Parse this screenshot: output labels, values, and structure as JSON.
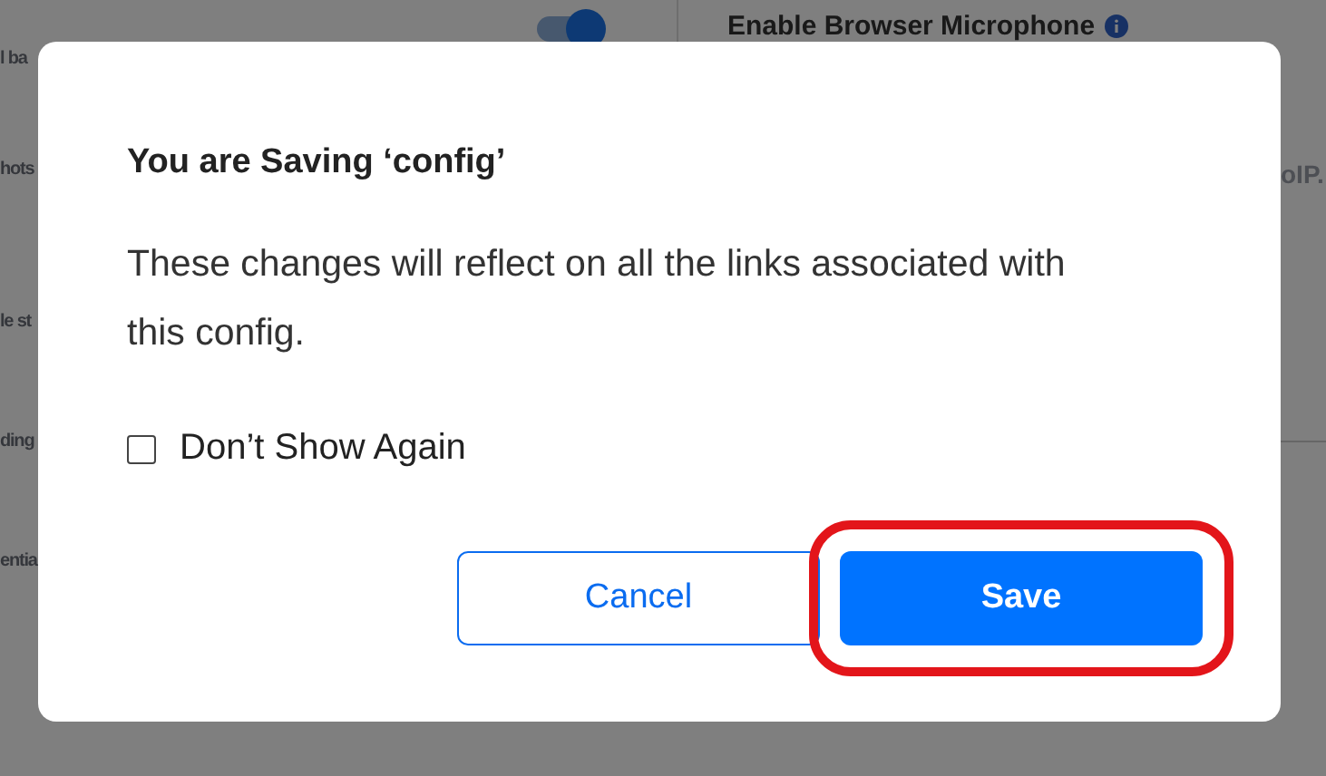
{
  "background": {
    "left_labels": [
      "l ba",
      "hots",
      "le st",
      "ding",
      "entia"
    ],
    "toggle": {
      "on": true
    },
    "section_title": "Enable Browser Microphone",
    "right_text": "oIP."
  },
  "dialog": {
    "title": "You are Saving ‘config’",
    "message": "These changes will reflect on all the links associated with this config.",
    "checkbox": {
      "label": "Don’t Show Again",
      "checked": false
    },
    "buttons": [
      {
        "label": "Cancel",
        "kind": "secondary",
        "highlighted": false
      },
      {
        "label": "Save",
        "kind": "primary",
        "highlighted": true
      }
    ]
  }
}
